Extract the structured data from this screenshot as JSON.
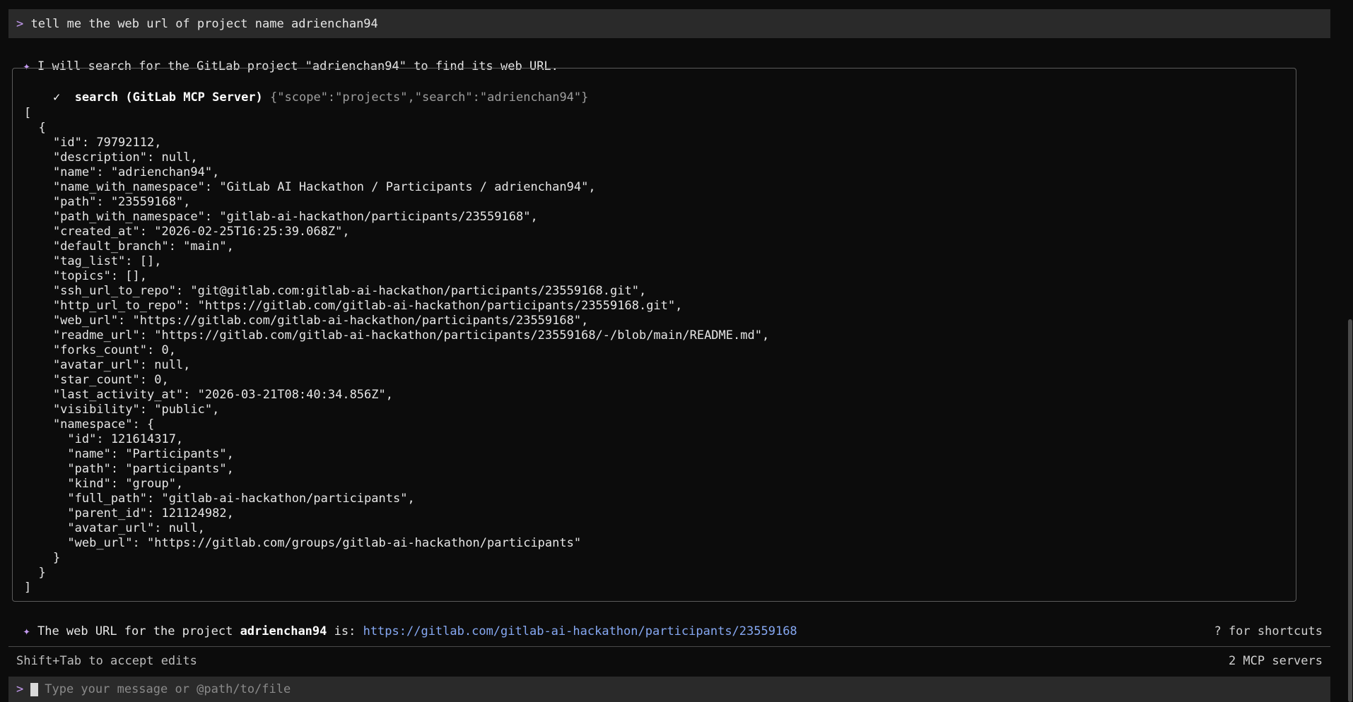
{
  "colors": {
    "background": "#0c0c0c",
    "bar_background": "#2a2a2a",
    "accent": "#c49bf0",
    "link": "#86a8f2",
    "muted": "#9e9e9e",
    "border": "#5c5c5c"
  },
  "user_prompt": {
    "caret": ">",
    "text": "tell me the web url of project name adrienchan94"
  },
  "assistant_intro": {
    "icon": "sparkle-icon",
    "icon_glyph": "✦",
    "text": "I will search for the GitLab project \"adrienchan94\" to find its web URL."
  },
  "tool_call": {
    "status_icon": "checkmark-icon",
    "status_glyph": "✓",
    "name": "search (GitLab MCP Server)",
    "args": "{\"scope\":\"projects\",\"search\":\"adrienchan94\"}",
    "output_lines": [
      "[",
      "  {",
      "    \"id\": 79792112,",
      "    \"description\": null,",
      "    \"name\": \"adrienchan94\",",
      "    \"name_with_namespace\": \"GitLab AI Hackathon / Participants / adrienchan94\",",
      "    \"path\": \"23559168\",",
      "    \"path_with_namespace\": \"gitlab-ai-hackathon/participants/23559168\",",
      "    \"created_at\": \"2026-02-25T16:25:39.068Z\",",
      "    \"default_branch\": \"main\",",
      "    \"tag_list\": [],",
      "    \"topics\": [],",
      "    \"ssh_url_to_repo\": \"git@gitlab.com:gitlab-ai-hackathon/participants/23559168.git\",",
      "    \"http_url_to_repo\": \"https://gitlab.com/gitlab-ai-hackathon/participants/23559168.git\",",
      "    \"web_url\": \"https://gitlab.com/gitlab-ai-hackathon/participants/23559168\",",
      "    \"readme_url\": \"https://gitlab.com/gitlab-ai-hackathon/participants/23559168/-/blob/main/README.md\",",
      "    \"forks_count\": 0,",
      "    \"avatar_url\": null,",
      "    \"star_count\": 0,",
      "    \"last_activity_at\": \"2026-03-21T08:40:34.856Z\",",
      "    \"visibility\": \"public\",",
      "    \"namespace\": {",
      "      \"id\": 121614317,",
      "      \"name\": \"Participants\",",
      "      \"path\": \"participants\",",
      "      \"kind\": \"group\",",
      "      \"full_path\": \"gitlab-ai-hackathon/participants\",",
      "      \"parent_id\": 121124982,",
      "      \"avatar_url\": null,",
      "      \"web_url\": \"https://gitlab.com/groups/gitlab-ai-hackathon/participants\"",
      "    }",
      "  }",
      "]"
    ]
  },
  "assistant_result": {
    "icon": "sparkle-icon",
    "icon_glyph": "✦",
    "prefix": "The web URL for the project ",
    "project": "adrienchan94",
    "middle": " is: ",
    "url": "https://gitlab.com/gitlab-ai-hackathon/participants/23559168"
  },
  "footer": {
    "shortcuts_hint": "? for shortcuts",
    "accept_edits_hint": "Shift+Tab to accept edits",
    "mcp_status": "2 MCP servers"
  },
  "input": {
    "caret": ">",
    "placeholder": "Type your message or @path/to/file",
    "value": ""
  }
}
